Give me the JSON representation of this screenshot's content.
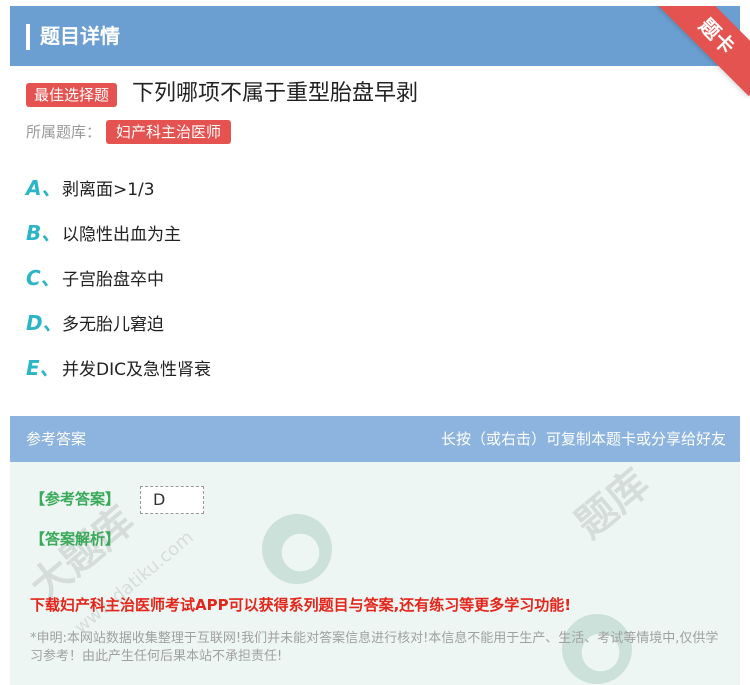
{
  "header": {
    "title": "题目详情",
    "ribbon": "题卡"
  },
  "question": {
    "type_tag": "最佳选择题",
    "text": "下列哪项不属于重型胎盘早剥",
    "bank_label": "所属题库：",
    "bank": "妇产科主治医师"
  },
  "options": [
    {
      "letter": "A、",
      "text": "剥离面>1/3"
    },
    {
      "letter": "B、",
      "text": "以隐性出血为主"
    },
    {
      "letter": "C、",
      "text": "子宫胎盘卒中"
    },
    {
      "letter": "D、",
      "text": "多无胎儿窘迫"
    },
    {
      "letter": "E、",
      "text": "并发DIC及急性肾衰"
    }
  ],
  "answer_section": {
    "title": "参考答案",
    "hint": "长按（或右击）可复制本题卡或分享给好友",
    "answer_label": "【参考答案】",
    "answer_value": "D",
    "analysis_label": "【答案解析】",
    "promo": "下载妇产科主治医师考试APP可以获得系列题目与答案,还有练习等更多学习功能!",
    "disclaimer": "*申明:本网站数据收集整理于互联网!我们并未能对答案信息进行核对!本信息不能用于生产、生活、考试等情境中,仅供学习参考！由此产生任何后果本站不承担责任!"
  },
  "colors": {
    "header": "#6c9fd1",
    "accent_red": "#e4534f",
    "option_letter": "#2bb5c6",
    "label_green": "#3aaa5a"
  }
}
